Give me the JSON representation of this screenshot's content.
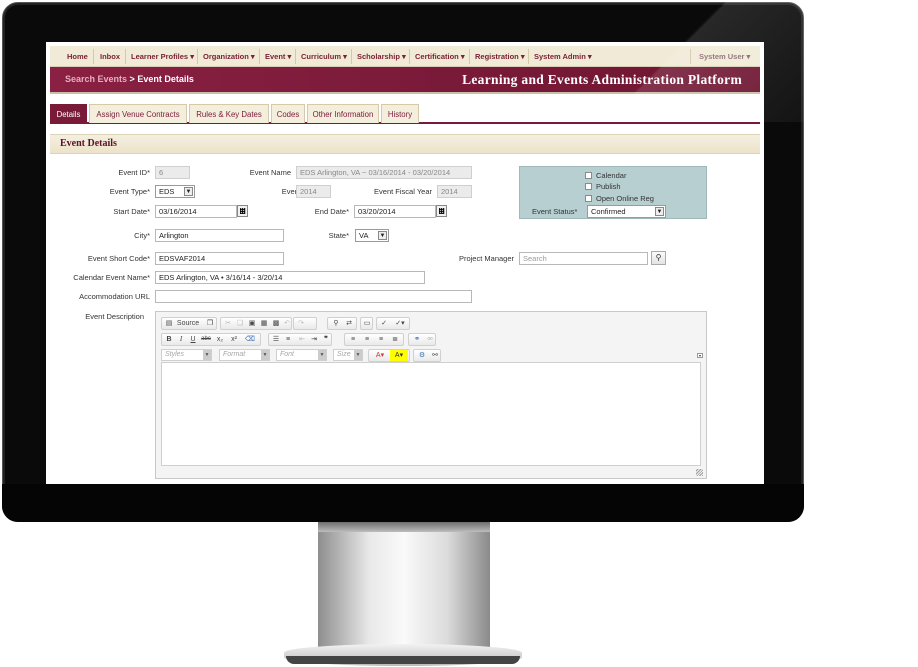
{
  "menu": {
    "items": [
      "Home",
      "Inbox",
      "Learner Profiles",
      "Organization",
      "Event",
      "Curriculum",
      "Scholarship",
      "Certification",
      "Registration",
      "System Admin"
    ],
    "user": "System User"
  },
  "header": {
    "breadcrumb_link": "Search Events",
    "breadcrumb_sep": " > ",
    "breadcrumb_current": "Event Details",
    "platform_title": "Learning and Events Administration Platform"
  },
  "tabs": [
    "Details",
    "Assign Venue Contracts",
    "Rules & Key Dates",
    "Codes",
    "Other Information",
    "History"
  ],
  "section_title": "Event Details",
  "form": {
    "event_id_label": "Event ID*",
    "event_id": "6",
    "event_name_label": "Event Name",
    "event_name": "EDS Arlington, VA ~ 03/16/2014 - 03/20/2014",
    "event_type_label": "Event Type*",
    "event_type": "EDS",
    "event_year_label": "Event Year",
    "event_year": "2014",
    "fiscal_year_label": "Event Fiscal Year",
    "fiscal_year": "2014",
    "start_date_label": "Start Date*",
    "start_date": "03/16/2014",
    "end_date_label": "End Date*",
    "end_date": "03/20/2014",
    "city_label": "City*",
    "city": "Arlington",
    "state_label": "State*",
    "state": "VA",
    "short_code_label": "Event Short Code*",
    "short_code": "EDSVAF2014",
    "project_manager_label": "Project Manager",
    "project_manager_placeholder": "Search",
    "calendar_name_label": "Calendar Event Name*",
    "calendar_name": "EDS Arlington, VA • 3/16/14 - 3/20/14",
    "accommodation_label": "Accommodation URL",
    "accommodation_url": "",
    "description_label": "Event Description"
  },
  "status_panel": {
    "calendar": "Calendar",
    "publish": "Publish",
    "open_online_reg": "Open Online Reg",
    "status_label": "Event Status*",
    "status": "Confirmed"
  },
  "editor": {
    "source_label": "Source",
    "styles": "Styles",
    "format": "Format",
    "font": "Font",
    "size": "Size"
  },
  "icons": {
    "apple_logo": "",
    "calendar": "calendar-icon",
    "lookup": "search-icon"
  }
}
